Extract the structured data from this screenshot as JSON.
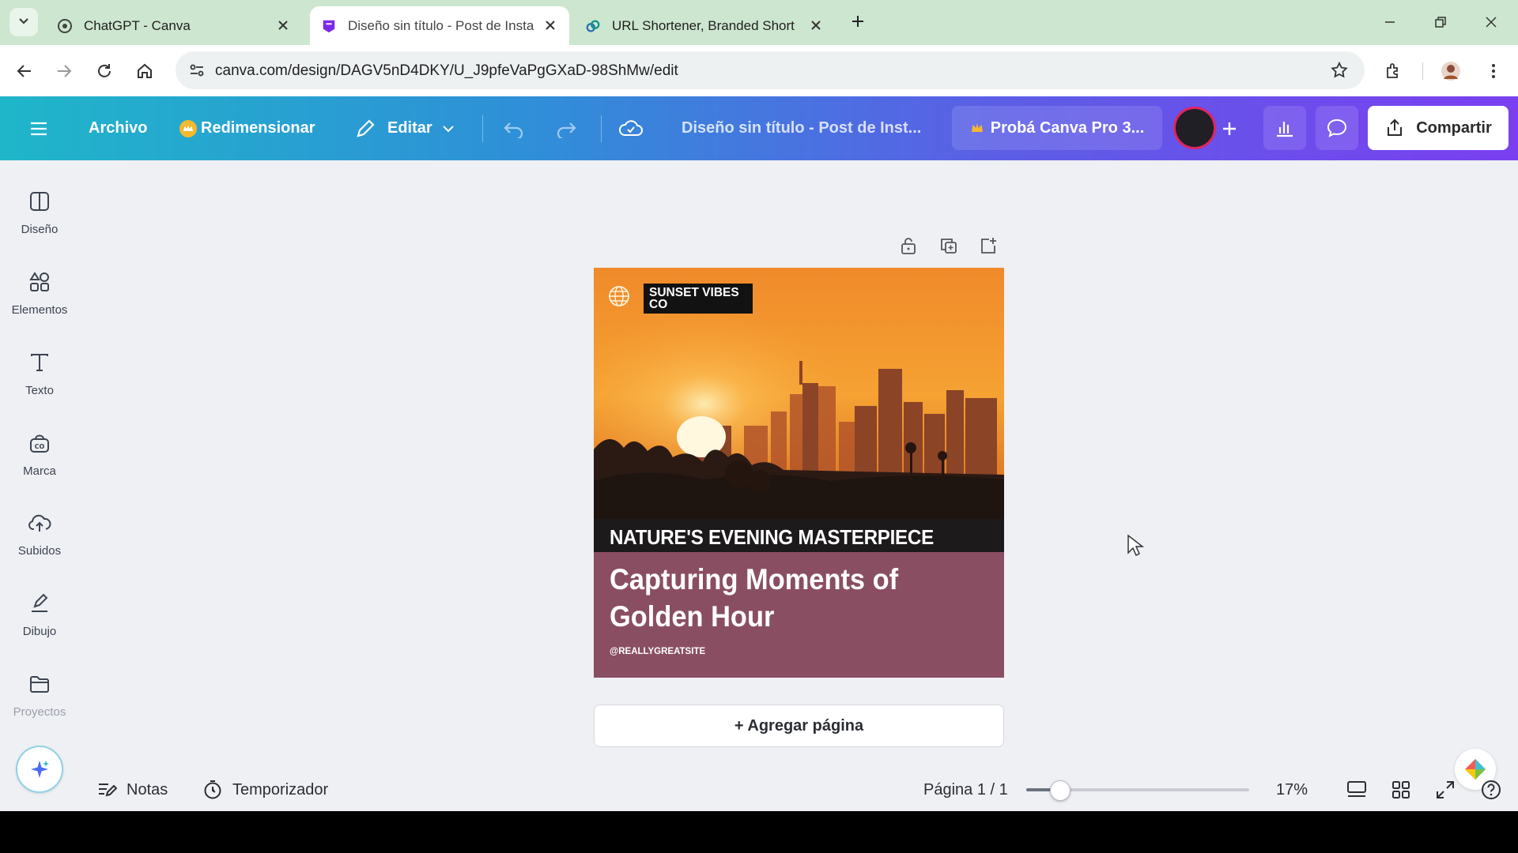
{
  "browser": {
    "tabs": [
      {
        "title": "ChatGPT - Canva",
        "active": false,
        "icon": "chatgpt-icon"
      },
      {
        "title": "Diseño sin título - Post de Insta",
        "active": true,
        "icon": "canva-icon"
      },
      {
        "title": "URL Shortener, Branded Short L",
        "active": false,
        "icon": "link-icon"
      }
    ],
    "url": "canva.com/design/DAGV5nD4DKY/U_J9pfeVaPgGXaD-98ShMw/edit"
  },
  "header": {
    "archivo": "Archivo",
    "redimensionar": "Redimensionar",
    "editar": "Editar",
    "doc_title": "Diseño sin título - Post de Inst...",
    "pro_trial": "Probá Canva Pro 3...",
    "share": "Compartir"
  },
  "sidebar": {
    "items": [
      {
        "label": "Diseño",
        "icon": "layout-icon"
      },
      {
        "label": "Elementos",
        "icon": "shapes-icon"
      },
      {
        "label": "Texto",
        "icon": "text-icon"
      },
      {
        "label": "Marca",
        "icon": "brand-icon"
      },
      {
        "label": "Subidos",
        "icon": "upload-cloud-icon"
      },
      {
        "label": "Dibujo",
        "icon": "draw-icon"
      },
      {
        "label": "Proyectos",
        "icon": "folder-icon"
      }
    ]
  },
  "design": {
    "brand": "SUNSET VIBES CO",
    "band_title": "NATURE'S EVENING MASTERPIECE",
    "headline": "Capturing Moments of Golden Hour",
    "handle": "@REALLYGREATSITE"
  },
  "canvas": {
    "add_page": "+ Agregar página"
  },
  "footer": {
    "notes": "Notas",
    "timer": "Temporizador",
    "page_indicator": "Página 1 / 1",
    "zoom": "17%",
    "zoom_fraction": 0.17
  },
  "colors": {
    "design_footer": "#8a4e63",
    "header_gradient_start": "#1fb6c9",
    "header_gradient_end": "#7a3ff0"
  }
}
